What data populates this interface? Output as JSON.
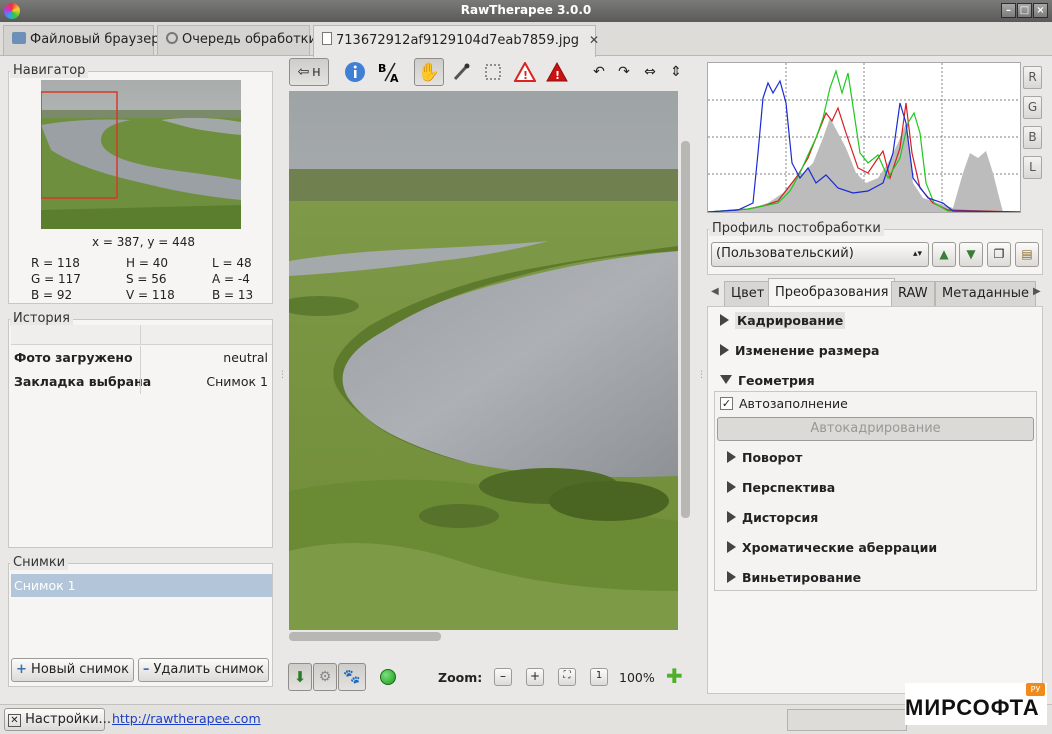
{
  "window": {
    "title": "RawTherapee 3.0.0"
  },
  "tabs": [
    {
      "label": "Файловый браузер"
    },
    {
      "label": "Очередь обработки"
    },
    {
      "label": "713672912af9129104d7eab7859.jpg"
    }
  ],
  "navigator": {
    "legend": "Навигатор",
    "coords": "x = 387, y = 448",
    "values": [
      [
        "R = 118",
        "H = 40",
        "L = 48"
      ],
      [
        "G = 117",
        "S = 56",
        "A = -4"
      ],
      [
        "B = 92",
        "V = 118",
        "B = 13"
      ]
    ]
  },
  "history": {
    "legend": "История",
    "rows": [
      {
        "action": "Фото загружено",
        "value": "neutral"
      },
      {
        "action": "Закладка выбрана",
        "value": "Снимок 1"
      }
    ]
  },
  "snapshots": {
    "legend": "Снимки",
    "items": [
      "Снимок 1"
    ],
    "new_label": "Новый снимок",
    "delete_label": "Удалить снимок"
  },
  "toolbar": {
    "hand_label": "H"
  },
  "bottombar": {
    "zoom_label": "Zoom:",
    "zoom_value": "100%"
  },
  "profile": {
    "legend": "Профиль постобработки",
    "selected": "(Пользовательский)"
  },
  "histogram_buttons": [
    "R",
    "G",
    "B",
    "L"
  ],
  "right_tabs": [
    "Цвет",
    "Преобразования",
    "RAW",
    "Метаданные"
  ],
  "sections": {
    "crop": "Кадрирование",
    "resize": "Изменение размера",
    "geometry": "Геометрия",
    "autofill": "Автозаполнение",
    "autocrop": "Автокадрирование",
    "rotate": "Поворот",
    "perspective": "Перспектива",
    "distortion": "Дисторсия",
    "ca": "Хроматические аберрации",
    "vignette": "Виньетирование"
  },
  "status": {
    "settings_label": "Настройки...",
    "link": "http://rawtherapee.com"
  },
  "watermark": {
    "text": "МИРСОФТА",
    "badge": "РУ"
  },
  "colors": {
    "accent": "#b8cde0",
    "link": "#1a3ec8",
    "selection": "#b3c5d8"
  }
}
